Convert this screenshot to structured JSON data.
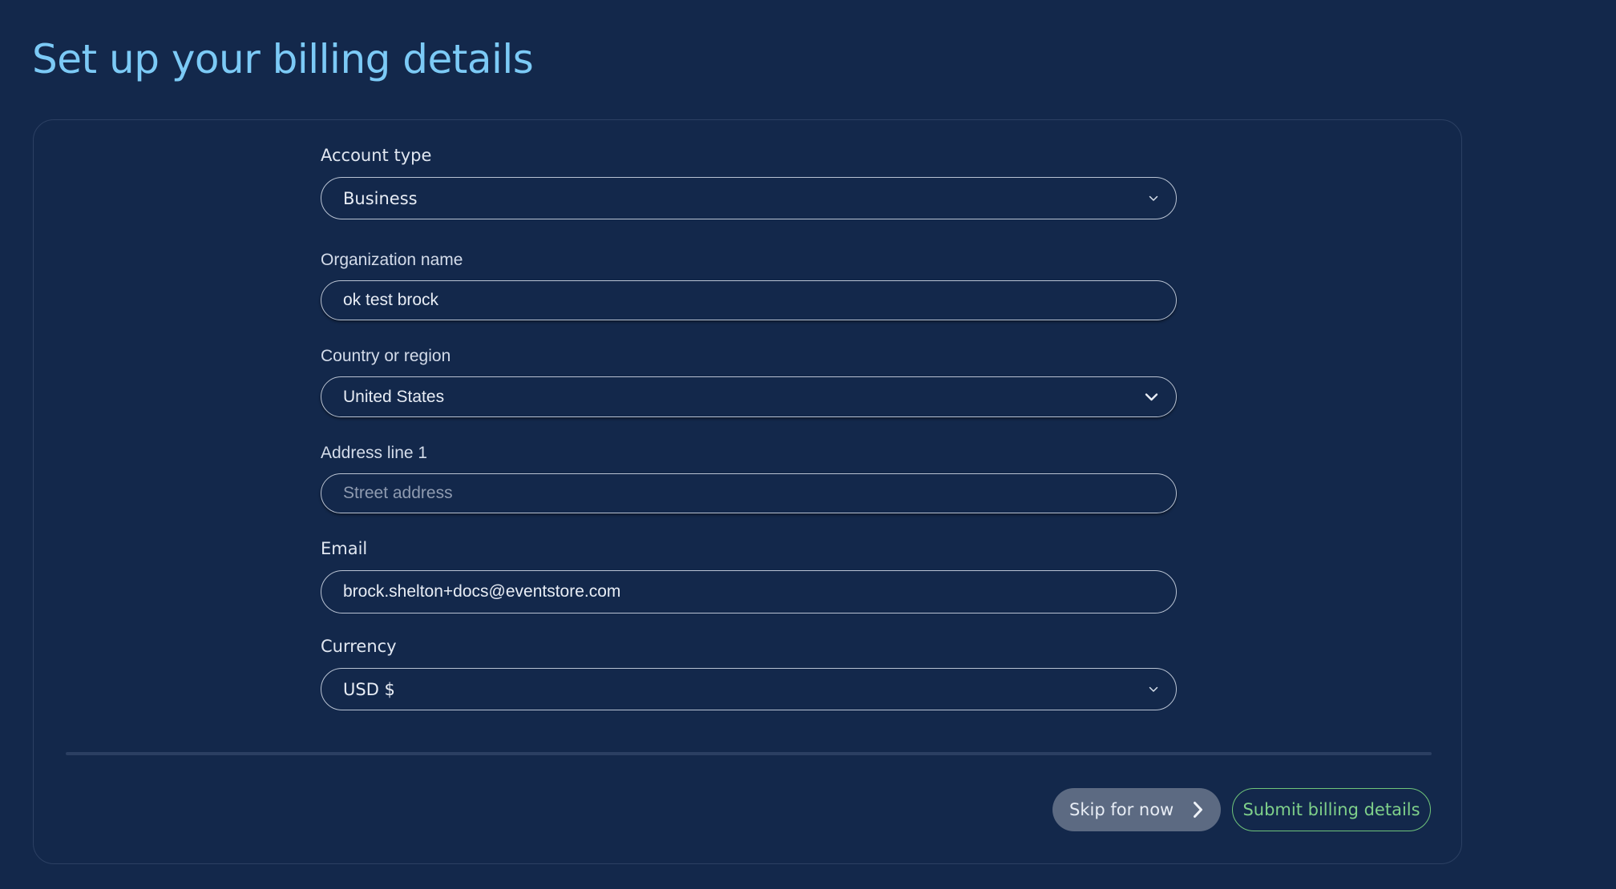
{
  "page": {
    "title": "Set up your billing details"
  },
  "form": {
    "account_type": {
      "label": "Account type",
      "value": "Business"
    },
    "organization_name": {
      "label": "Organization name",
      "value": "ok test brock"
    },
    "country": {
      "label": "Country or region",
      "value": "United States"
    },
    "address_line_1": {
      "label": "Address line 1",
      "value": "",
      "placeholder": "Street address"
    },
    "email": {
      "label": "Email",
      "value": "brock.shelton+docs@eventstore.com"
    },
    "currency": {
      "label": "Currency",
      "value": "USD $"
    }
  },
  "actions": {
    "skip_label": "Skip for now",
    "submit_label": "Submit billing details"
  },
  "icons": {
    "select_chevron": "chevron-down-icon",
    "skip_arrow": "chevron-right-icon"
  },
  "colors": {
    "background": "#13284b",
    "title": "#7ccaf6",
    "submit_accent": "#6fc47a",
    "skip_bg": "#5c6a82"
  }
}
